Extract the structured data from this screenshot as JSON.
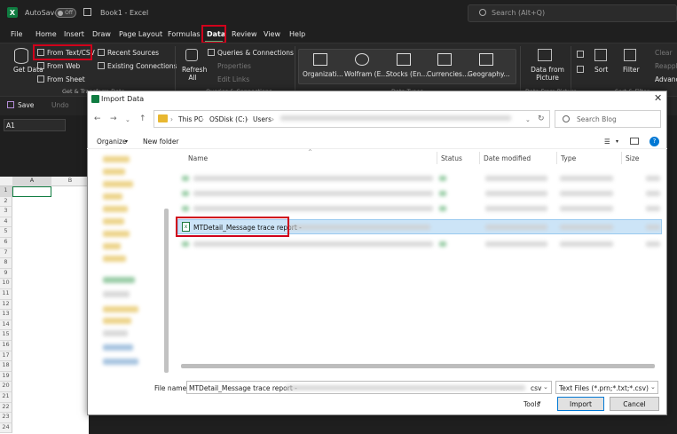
{
  "titlebar": {
    "autosave_label": "AutoSave",
    "autosave_state": "Off",
    "book_title": "Book1 - Excel",
    "search_placeholder": "Search (Alt+Q)"
  },
  "tabs": [
    "File",
    "Home",
    "Insert",
    "Draw",
    "Page Layout",
    "Formulas",
    "Data",
    "Review",
    "View",
    "Help"
  ],
  "active_tab": "Data",
  "ribbon": {
    "get_data": "Get Data",
    "from_text_csv": "From Text/CSV",
    "from_web": "From Web",
    "from_sheet": "From Sheet",
    "recent_sources": "Recent Sources",
    "existing_connections": "Existing Connections",
    "group_get_transform": "Get & Transform Data",
    "refresh_all": "Refresh All",
    "queries_connections": "Queries & Connections",
    "properties": "Properties",
    "edit_links": "Edit Links",
    "group_queries": "Queries & Connections",
    "datatypes": [
      "Organizati...",
      "Wolfram (E...",
      "Stocks (En...",
      "Currencies...",
      "Geography..."
    ],
    "group_datatypes": "Data Types",
    "data_from_picture": "Data from Picture",
    "group_picture": "Data From Picture",
    "sort": "Sort",
    "filter": "Filter",
    "clear": "Clear",
    "reapply": "Reapply",
    "advanced": "Advanced",
    "group_sort_filter": "Sort & Filter"
  },
  "qab": {
    "save": "Save",
    "undo": "Undo"
  },
  "namebox": "A1",
  "sheet": {
    "columns": [
      "A",
      "B"
    ],
    "rows": [
      "1",
      "2",
      "3",
      "4",
      "5",
      "6",
      "7",
      "8",
      "9",
      "10",
      "11",
      "12",
      "13",
      "14",
      "15",
      "16",
      "17",
      "18",
      "19",
      "20",
      "21",
      "22",
      "23",
      "24"
    ]
  },
  "dialog": {
    "title": "Import Data",
    "breadcrumb": [
      "This PC",
      "OSDisk (C:)",
      "Users"
    ],
    "search_placeholder": "Search Blog",
    "organize": "Organize",
    "new_folder": "New folder",
    "columns": [
      "Name",
      "Status",
      "Date modified",
      "Type",
      "Size"
    ],
    "selected_file": "MTDetail_Message trace report -",
    "file_name_label": "File name:",
    "file_name_value": "MTDetail_Message trace report -",
    "file_name_ext": "csv",
    "file_type": "Text Files (*.prn;*.txt;*.csv)",
    "tools": "Tools",
    "import": "Import",
    "cancel": "Cancel"
  },
  "colors": {
    "accent_green": "#107c41",
    "highlight_red": "#d0021b",
    "selection": "#cce4f7"
  }
}
